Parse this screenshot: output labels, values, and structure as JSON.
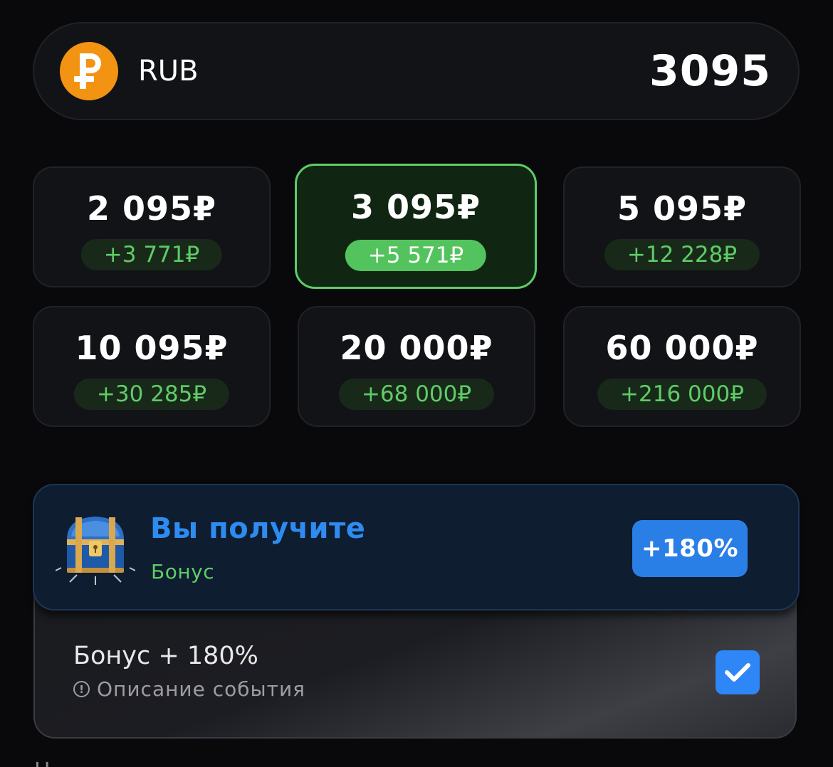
{
  "currency": {
    "code": "RUB",
    "balance": "3095",
    "icon": "ruble-coin-icon",
    "icon_color": "#f29412"
  },
  "amounts": [
    {
      "value": "2 095₽",
      "bonus": "+3 771₽",
      "selected": false
    },
    {
      "value": "3 095₽",
      "bonus": "+5 571₽",
      "selected": true
    },
    {
      "value": "5 095₽",
      "bonus": "+12 228₽",
      "selected": false
    },
    {
      "value": "10 095₽",
      "bonus": "+30 285₽",
      "selected": false
    },
    {
      "value": "20 000₽",
      "bonus": "+68 000₽",
      "selected": false
    },
    {
      "value": "60 000₽",
      "bonus": "+216 000₽",
      "selected": false
    }
  ],
  "bonus": {
    "title": "Вы получите",
    "subtitle": "Бонус",
    "percent": "+180%",
    "icon": "treasure-chest-icon",
    "option": {
      "title": "Бонус + 180%",
      "description": "Описание события",
      "checked": true
    }
  },
  "colors": {
    "accent_green": "#5fcc67",
    "accent_blue": "#2e8bf0",
    "background": "#09090c"
  }
}
